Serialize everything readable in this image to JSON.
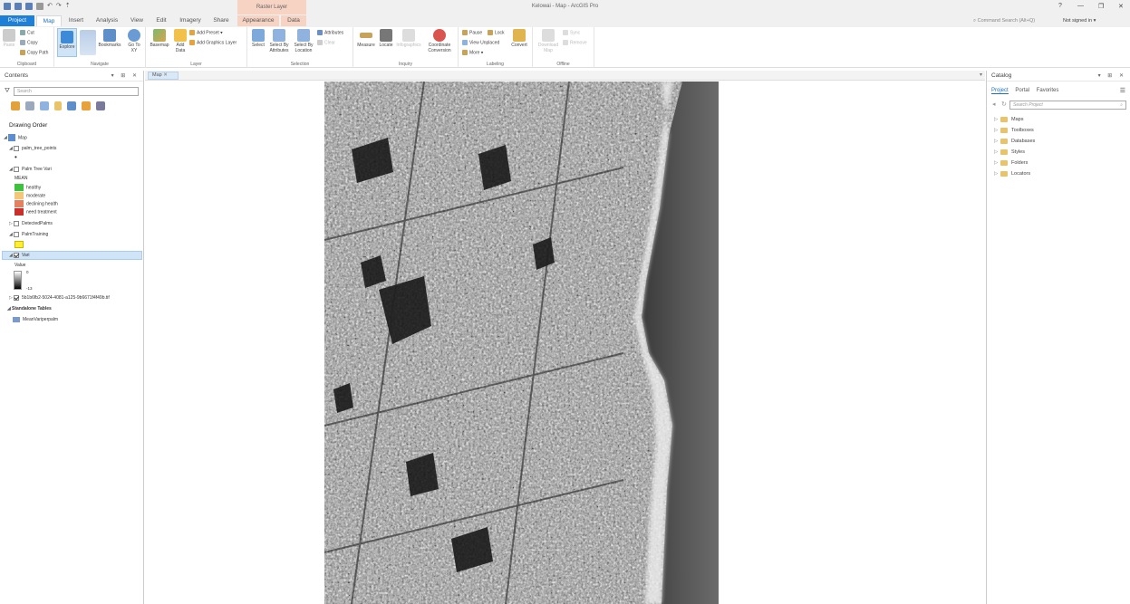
{
  "window": {
    "title": "Kelowai - Map - ArcGIS Pro",
    "context_tab_group": "Raster Layer",
    "help": "?",
    "minimize": "—",
    "restore": "❐",
    "close": "✕"
  },
  "tabs": {
    "project": "Project",
    "map": "Map",
    "insert": "Insert",
    "analysis": "Analysis",
    "view": "View",
    "edit": "Edit",
    "imagery": "Imagery",
    "share": "Share",
    "appearance": "Appearance",
    "data": "Data"
  },
  "command_search": "Command Search (Alt+Q)",
  "signed_in": "Not signed in ▾",
  "ribbon": {
    "clipboard": {
      "label": "Clipboard",
      "paste": "Paste",
      "cut": "Cut",
      "copy": "Copy",
      "copy_path": "Copy Path"
    },
    "navigate": {
      "label": "Navigate",
      "explore": "Explore",
      "bookmarks": "Bookmarks",
      "go_to_xy": "Go To XY"
    },
    "layer": {
      "label": "Layer",
      "basemap": "Basemap",
      "add_data": "Add Data",
      "add_preset": "Add Preset ▾",
      "add_graphics_layer": "Add Graphics Layer"
    },
    "selection": {
      "label": "Selection",
      "select": "Select",
      "select_by_attributes": "Select By Attributes",
      "select_by_location": "Select By Location",
      "attributes": "Attributes",
      "clear": "Clear"
    },
    "inquiry": {
      "label": "Inquiry",
      "measure": "Measure",
      "locate": "Locate",
      "infographics": "Infographics",
      "coordinate_conversion": "Coordinate Conversion"
    },
    "labeling": {
      "label": "Labeling",
      "pause": "Pause",
      "lock": "Lock",
      "view_unplaced": "View Unplaced",
      "more": "More ▾",
      "convert": "Convert"
    },
    "offline": {
      "label": "Offline",
      "download_map": "Download Map",
      "sync": "Sync",
      "remove": "Remove"
    }
  },
  "contents": {
    "title": "Contents",
    "search_placeholder": "Search",
    "drawing_order": "Drawing Order",
    "map": "Map",
    "layer_points": "palm_tree_points",
    "layer_vari": "Palm Tree Vari",
    "mean": "MEAN",
    "classes": [
      {
        "label": "healthy",
        "color": "#3bc43b"
      },
      {
        "label": "moderate",
        "color": "#f2c77a"
      },
      {
        "label": "declining health",
        "color": "#e6805e"
      },
      {
        "label": "need treatment",
        "color": "#c9302c"
      }
    ],
    "layer_detected": "DetectedPalms",
    "layer_training": "PalmTraining",
    "training_color": "#ffee33",
    "layer_selected": "Vari",
    "value_label": "Value",
    "value_high": "0",
    "value_low": "-13",
    "layer_raster": "5b1b6fb2-5024-4081-a125-9b6671f4f49b.tif",
    "standalone_tables": "Standalone Tables",
    "table": "MeanVariperpalm"
  },
  "map_tab": "Map",
  "catalog": {
    "title": "Catalog",
    "tabs": [
      "Project",
      "Portal",
      "Favorites"
    ],
    "search_placeholder": "Search Project",
    "items": [
      "Maps",
      "Toolboxes",
      "Databases",
      "Styles",
      "Folders",
      "Locators"
    ]
  }
}
